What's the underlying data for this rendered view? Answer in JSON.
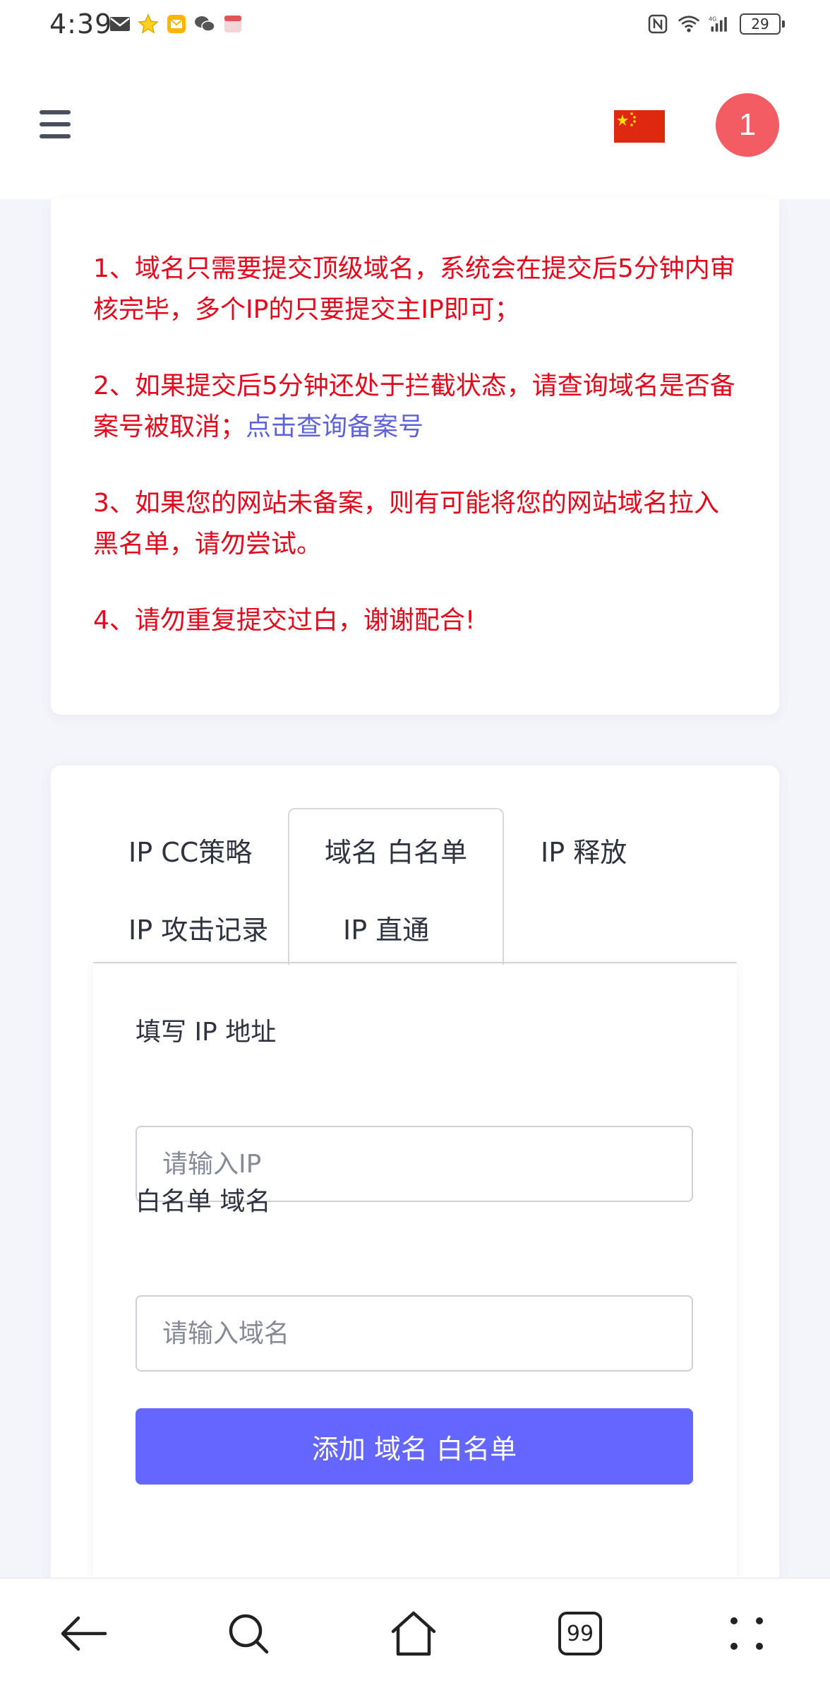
{
  "status_bar": {
    "time": "4:39",
    "battery": "29"
  },
  "header": {
    "badge_count": "1"
  },
  "notice": {
    "items": [
      {
        "text": "1、域名只需要提交顶级域名，系统会在提交后5分钟内审核完毕，多个IP的只要提交主IP即可；"
      },
      {
        "text": "2、如果提交后5分钟还处于拦截状态，请查询域名是否备案号被取消；",
        "link": "点击查询备案号"
      },
      {
        "text": "3、如果您的网站未备案，则有可能将您的网站域名拉入黑名单，请勿尝试。"
      },
      {
        "text": "4、请勿重复提交过白，谢谢配合!"
      }
    ]
  },
  "tabs": [
    {
      "label": "IP CC策略"
    },
    {
      "label": "域名 白名单"
    },
    {
      "label": "IP 释放"
    },
    {
      "label": "IP 攻击记录"
    },
    {
      "label": "IP 直通"
    }
  ],
  "form": {
    "ip_label": "填写 IP 地址",
    "ip_placeholder": "请输入IP",
    "domain_label": "白名单 域名",
    "domain_placeholder": "请输入域名",
    "submit_label": "添加 域名 白名单"
  },
  "bottom_nav": {
    "tabs_count": "99"
  },
  "colors": {
    "notice_red": "#e3081b",
    "link_purple": "#5f63d8",
    "primary_button": "#6366ff",
    "badge_red": "#f25c62"
  }
}
